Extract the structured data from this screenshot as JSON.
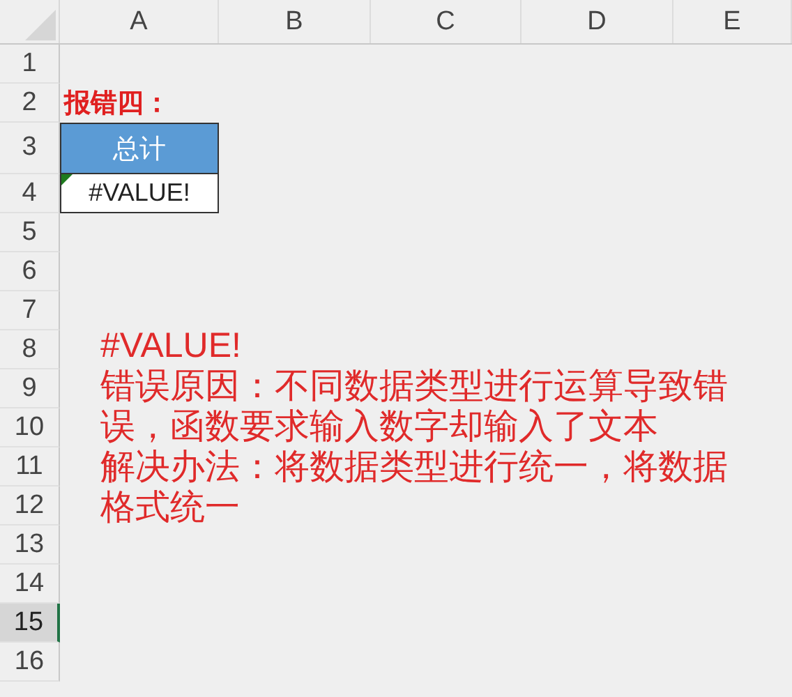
{
  "columns": [
    {
      "label": "A"
    },
    {
      "label": "B"
    },
    {
      "label": "C"
    },
    {
      "label": "D"
    },
    {
      "label": "E"
    }
  ],
  "rows": [
    {
      "label": "1",
      "selected": false,
      "cells": []
    },
    {
      "label": "2",
      "selected": false,
      "cells": [
        {
          "kind": "label",
          "text": "报错四："
        }
      ]
    },
    {
      "label": "3",
      "selected": false,
      "cells": [
        {
          "kind": "header",
          "text": "总计"
        }
      ]
    },
    {
      "label": "4",
      "selected": false,
      "cells": [
        {
          "kind": "value",
          "text": "#VALUE!",
          "error_indicator": true
        }
      ]
    },
    {
      "label": "5",
      "selected": false,
      "cells": []
    },
    {
      "label": "6",
      "selected": false,
      "cells": []
    },
    {
      "label": "7",
      "selected": false,
      "cells": []
    },
    {
      "label": "8",
      "selected": false,
      "cells": []
    },
    {
      "label": "9",
      "selected": false,
      "cells": []
    },
    {
      "label": "10",
      "selected": false,
      "cells": []
    },
    {
      "label": "11",
      "selected": false,
      "cells": []
    },
    {
      "label": "12",
      "selected": false,
      "cells": []
    },
    {
      "label": "13",
      "selected": false,
      "cells": []
    },
    {
      "label": "14",
      "selected": false,
      "cells": []
    },
    {
      "label": "15",
      "selected": true,
      "cells": []
    },
    {
      "label": "16",
      "selected": false,
      "cells": []
    }
  ],
  "note": {
    "lines": [
      "#VALUE!",
      "错误原因：不同数据类型进行运算导致错误，函数要求输入数字却输入了文本",
      "解决办法：将数据类型进行统一，将数据格式统一"
    ]
  }
}
